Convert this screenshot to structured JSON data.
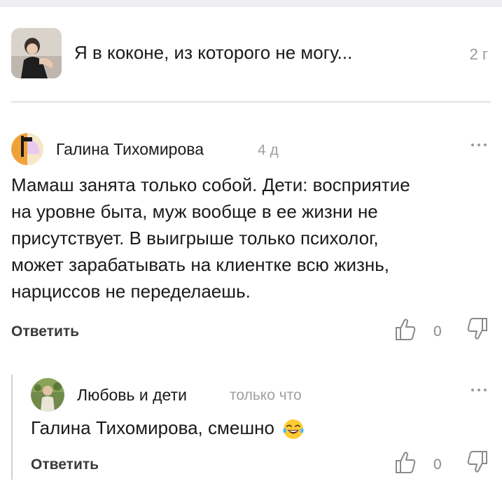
{
  "article": {
    "title": "Я в коконе, из которого не могу...",
    "time": "2 г"
  },
  "comments": [
    {
      "author": "Галина Тихомирова",
      "time": "4 д",
      "text": "Мамаш занята только собой. Дети: восприятие\nна  уровне быта, муж вообще  в ее жизни не\nприсутствует. В выигрыше  только психолог,\nможет зарабатывать на клиентке всю жизнь,\nнарциссов не переделаешь.",
      "reply_label": "Ответить",
      "votes": "0"
    },
    {
      "author": "Любовь и дети",
      "time": "только что",
      "text": "Галина Тихомирова, смешно",
      "emoji": "face-with-tears-of-joy-icon",
      "reply_label": "Ответить",
      "votes": "0"
    }
  ],
  "colors": {
    "text": "#1a1a1a",
    "muted": "#9a9a9a",
    "divider": "#c8c8c8",
    "avatar_accent": "#f0a23a"
  }
}
